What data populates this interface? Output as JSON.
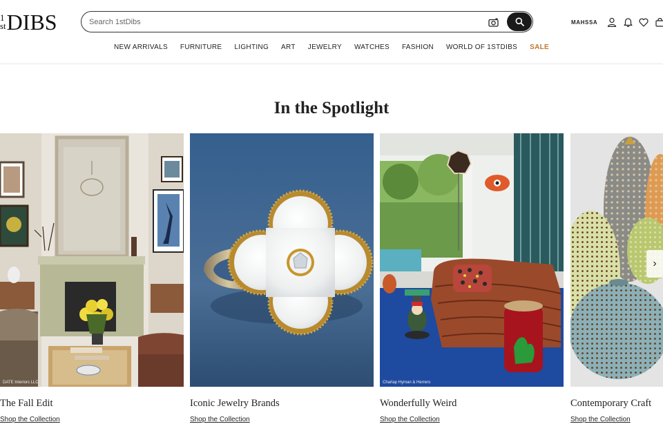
{
  "brand": {
    "logo_sup_top": "1",
    "logo_sup_bottom": "st",
    "logo_main": "DIBS"
  },
  "search": {
    "placeholder": "Search 1stDibs"
  },
  "account": {
    "name": "MAHSSA"
  },
  "nav": {
    "items": [
      "NEW ARRIVALS",
      "FURNITURE",
      "LIGHTING",
      "ART",
      "JEWELRY",
      "WATCHES",
      "FASHION",
      "WORLD OF 1STDIBS"
    ],
    "sale": "SALE"
  },
  "section": {
    "title": "In the Spotlight"
  },
  "cards": [
    {
      "caption": "The Fall Edit",
      "link": "Shop the Collection",
      "credit": "DATE Interiors LLC"
    },
    {
      "caption": "Iconic Jewelry Brands",
      "link": "Shop the Collection",
      "credit": ""
    },
    {
      "caption": "Wonderfully Weird",
      "link": "Shop the Collection",
      "credit": "Charlap Hyman & Herrero"
    },
    {
      "caption": "Contemporary Craft",
      "link": "Shop the Collection",
      "credit": ""
    }
  ],
  "colors": {
    "sale": "#c2762c",
    "search_button": "#1a1a1a"
  },
  "icons": {
    "camera": "camera-icon",
    "search": "search-icon",
    "user": "user-icon",
    "bell": "bell-icon",
    "heart": "heart-icon",
    "bag": "bag-icon",
    "next": "chevron-right-icon"
  }
}
